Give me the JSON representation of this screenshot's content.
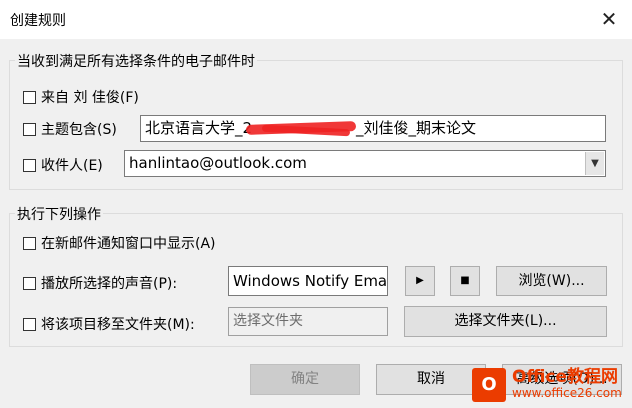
{
  "window": {
    "title": "创建规则",
    "close_glyph": "✕"
  },
  "conditions": {
    "group_label": "当收到满足所有选择条件的电子邮件时",
    "from_label": "来自 刘 佳俊(F)",
    "subject_label": "主题包含(S)",
    "subject_value_prefix": "北京语言大学_2",
    "subject_value_suffix": "_刘佳俊_期末论文",
    "recipient_label": "收件人(E)",
    "recipient_value": "hanlintao@outlook.com"
  },
  "actions": {
    "group_label": "执行下列操作",
    "alert_label": "在新邮件通知窗口中显示(A)",
    "sound_label": "播放所选择的声音(P):",
    "sound_value": "Windows Notify Email",
    "play_glyph": "▶",
    "stop_glyph": "■",
    "browse_label": "浏览(W)...",
    "move_label": "将该项目移至文件夹(M):",
    "folder_placeholder": "选择文件夹",
    "choose_folder_label": "选择文件夹(L)..."
  },
  "footer": {
    "ok_label": "确定",
    "cancel_label": "取消",
    "advanced_label": "高级选项(O)..."
  },
  "watermark": {
    "logo_letter": "O",
    "line1": "Office教程网",
    "line2": "www.office26.com"
  },
  "colors": {
    "accent": "#eb3c00",
    "scribble": "#ee2222"
  }
}
